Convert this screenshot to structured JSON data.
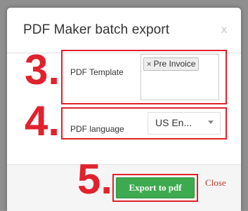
{
  "dialog": {
    "title": "PDF Maker batch export",
    "close_symbol": "x"
  },
  "steps": {
    "template_number": "3.",
    "language_number": "4.",
    "export_number": "5."
  },
  "fields": {
    "template_label": "PDF Template",
    "template_tags": [
      {
        "remove_symbol": "×",
        "label": "Pre Invoice"
      }
    ],
    "language_label": "PDF language",
    "language_value": "US En..."
  },
  "footer": {
    "export_label": "Export to pdf",
    "close_label": "Close"
  },
  "colors": {
    "annotation_red": "#e0222d",
    "export_green": "#3eaa4f",
    "close_link": "#c0392b"
  },
  "icons": {
    "select_arrow": "chevron-down-icon",
    "tag_remove": "close-icon"
  }
}
